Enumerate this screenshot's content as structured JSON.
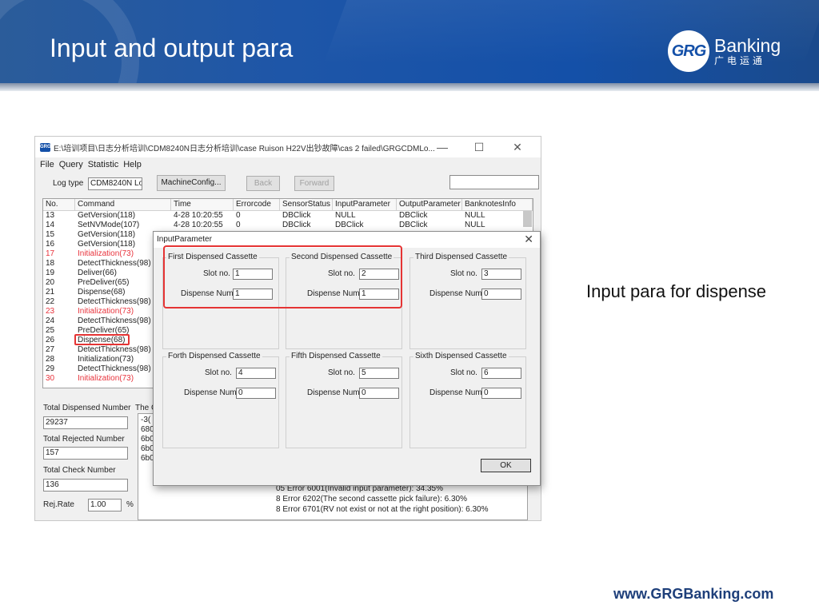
{
  "slide": {
    "title": "Input and output para",
    "caption": "Input para for dispense",
    "footer_url": "www.GRGBanking.com",
    "logo": {
      "mark": "GRG",
      "brand": "Banking",
      "sub": "广电运通"
    }
  },
  "colors": {
    "banner": "#1450a8",
    "highlight": "#e53434",
    "error_row": "#e8333c"
  },
  "window": {
    "icon_text": "GRG",
    "path": "E:\\培训项目\\日志分析培训\\CDM8240N日志分析培训\\case Ruison H22V出钞故障\\cas 2 failed\\GRGCDMLo...",
    "controls": {
      "minimize": "—",
      "maximize": "☐",
      "close": "✕"
    },
    "menu": [
      "File",
      "Query",
      "Statistic",
      "Help"
    ],
    "toolbar": {
      "log_type_label": "Log type",
      "log_type_value": "CDM8240N Log",
      "machine_config": "MachineConfig...",
      "back": "Back",
      "forward": "Forward"
    },
    "grid": {
      "columns": [
        "No.",
        "Command",
        "Time",
        "Errorcode",
        "SensorStatus",
        "InputParameter",
        "OutputParameter",
        "BanknotesInfo"
      ],
      "rows": [
        {
          "no": "13",
          "cmd": "GetVersion(118)",
          "time": "4-28 10:20:55",
          "err": "0",
          "sensor": "DBClick",
          "input": "NULL",
          "output": "DBClick",
          "notes": "NULL",
          "red": false
        },
        {
          "no": "14",
          "cmd": "SetNVMode(107)",
          "time": "4-28 10:20:55",
          "err": "0",
          "sensor": "DBClick",
          "input": "DBClick",
          "output": "DBClick",
          "notes": "NULL",
          "red": false
        },
        {
          "no": "15",
          "cmd": "GetVersion(118)",
          "time": "",
          "err": "",
          "sensor": "",
          "input": "",
          "output": "",
          "notes": "",
          "red": false
        },
        {
          "no": "16",
          "cmd": "GetVersion(118)",
          "time": "",
          "err": "",
          "sensor": "",
          "input": "",
          "output": "",
          "notes": "",
          "red": false
        },
        {
          "no": "17",
          "cmd": "Initialization(73)",
          "time": "",
          "err": "",
          "sensor": "",
          "input": "",
          "output": "",
          "notes": "",
          "red": true
        },
        {
          "no": "18",
          "cmd": "DetectThickness(98)",
          "time": "",
          "err": "",
          "sensor": "",
          "input": "",
          "output": "",
          "notes": "",
          "red": false
        },
        {
          "no": "19",
          "cmd": "Deliver(66)",
          "time": "",
          "err": "",
          "sensor": "",
          "input": "",
          "output": "",
          "notes": "",
          "red": false
        },
        {
          "no": "20",
          "cmd": "PreDeliver(65)",
          "time": "",
          "err": "",
          "sensor": "",
          "input": "",
          "output": "",
          "notes": "",
          "red": false
        },
        {
          "no": "21",
          "cmd": "Dispense(68)",
          "time": "",
          "err": "",
          "sensor": "",
          "input": "",
          "output": "",
          "notes": "",
          "red": false
        },
        {
          "no": "22",
          "cmd": "DetectThickness(98)",
          "time": "",
          "err": "",
          "sensor": "",
          "input": "",
          "output": "",
          "notes": "",
          "red": false
        },
        {
          "no": "23",
          "cmd": "Initialization(73)",
          "time": "",
          "err": "",
          "sensor": "",
          "input": "",
          "output": "",
          "notes": "",
          "red": true
        },
        {
          "no": "24",
          "cmd": "DetectThickness(98)",
          "time": "",
          "err": "",
          "sensor": "",
          "input": "",
          "output": "",
          "notes": "",
          "red": false
        },
        {
          "no": "25",
          "cmd": "PreDeliver(65)",
          "time": "",
          "err": "",
          "sensor": "",
          "input": "",
          "output": "",
          "notes": "",
          "red": false
        },
        {
          "no": "26",
          "cmd": "Dispense(68)",
          "time": "",
          "err": "",
          "sensor": "",
          "input": "",
          "output": "",
          "notes": "",
          "red": false
        },
        {
          "no": "27",
          "cmd": "DetectThickness(98)",
          "time": "",
          "err": "",
          "sensor": "",
          "input": "",
          "output": "",
          "notes": "",
          "red": false
        },
        {
          "no": "28",
          "cmd": "Initialization(73)",
          "time": "",
          "err": "",
          "sensor": "",
          "input": "",
          "output": "",
          "notes": "",
          "red": false
        },
        {
          "no": "29",
          "cmd": "DetectThickness(98)",
          "time": "",
          "err": "",
          "sensor": "",
          "input": "",
          "output": "",
          "notes": "",
          "red": false
        },
        {
          "no": "30",
          "cmd": "Initialization(73)",
          "time": "",
          "err": "",
          "sensor": "",
          "input": "",
          "output": "",
          "notes": "",
          "red": true
        }
      ]
    },
    "stats": {
      "total_dispensed_label": "Total Dispensed Number",
      "total_dispensed_value": "29237",
      "total_rejected_label": "Total Rejected Number",
      "total_rejected_value": "157",
      "total_check_label": "Total Check Number",
      "total_check_value": "136",
      "rej_rate_label": "Rej.Rate",
      "rej_rate_value": "1.00",
      "rej_rate_unit": "%",
      "log_header": "The C"
    },
    "log_lines": [
      "-3(",
      "680",
      "6b0",
      "6b0",
      "6b0",
      "05 Error 6001(Invalid input parameter): 34.35%",
      "8 Error 6202(The second cassette pick failure): 6.30%",
      "8 Error 6701(RV not exist or not at the right position): 6.30%"
    ]
  },
  "dialog": {
    "title": "InputParameter",
    "close": "✕",
    "slot_label": "Slot no.",
    "num_label": "Dispense Num",
    "ok": "OK",
    "cassettes": [
      {
        "title": "First Dispensed Cassette",
        "slot": "1",
        "num": "1"
      },
      {
        "title": "Second Dispensed Cassette",
        "slot": "2",
        "num": "1"
      },
      {
        "title": "Third Dispensed Cassette",
        "slot": "3",
        "num": "0"
      },
      {
        "title": "Forth Dispensed Cassette",
        "slot": "4",
        "num": "0"
      },
      {
        "title": "Fifth Dispensed Cassette",
        "slot": "5",
        "num": "0"
      },
      {
        "title": "Sixth Dispensed Cassette",
        "slot": "6",
        "num": "0"
      }
    ]
  }
}
